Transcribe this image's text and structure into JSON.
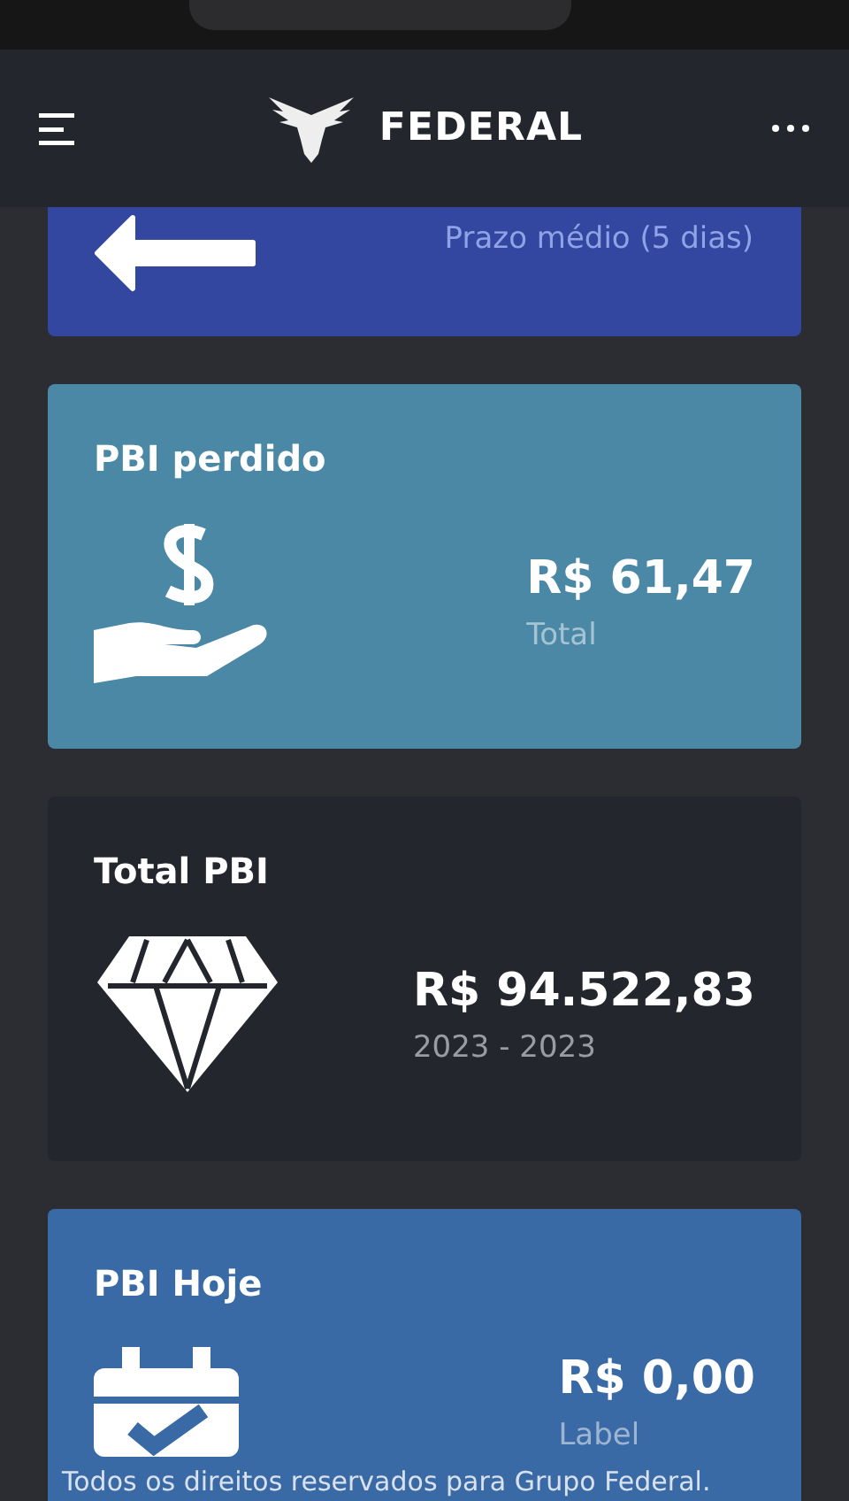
{
  "header": {
    "brand": "FEDERAL"
  },
  "cards": [
    {
      "kind": "arrow",
      "caption": "Prazo médio (5 dias)"
    },
    {
      "kind": "money",
      "title": "PBI perdido",
      "value": "R$ 61,47",
      "caption": "Total"
    },
    {
      "kind": "diamond",
      "title": "Total PBI",
      "value": "R$ 94.522,83",
      "caption": "2023 - 2023"
    },
    {
      "kind": "calendar",
      "title": "PBI Hoje",
      "value": "R$ 0,00",
      "caption": "Label"
    }
  ],
  "footer": "Todos os direitos reservados para Grupo Federal."
}
